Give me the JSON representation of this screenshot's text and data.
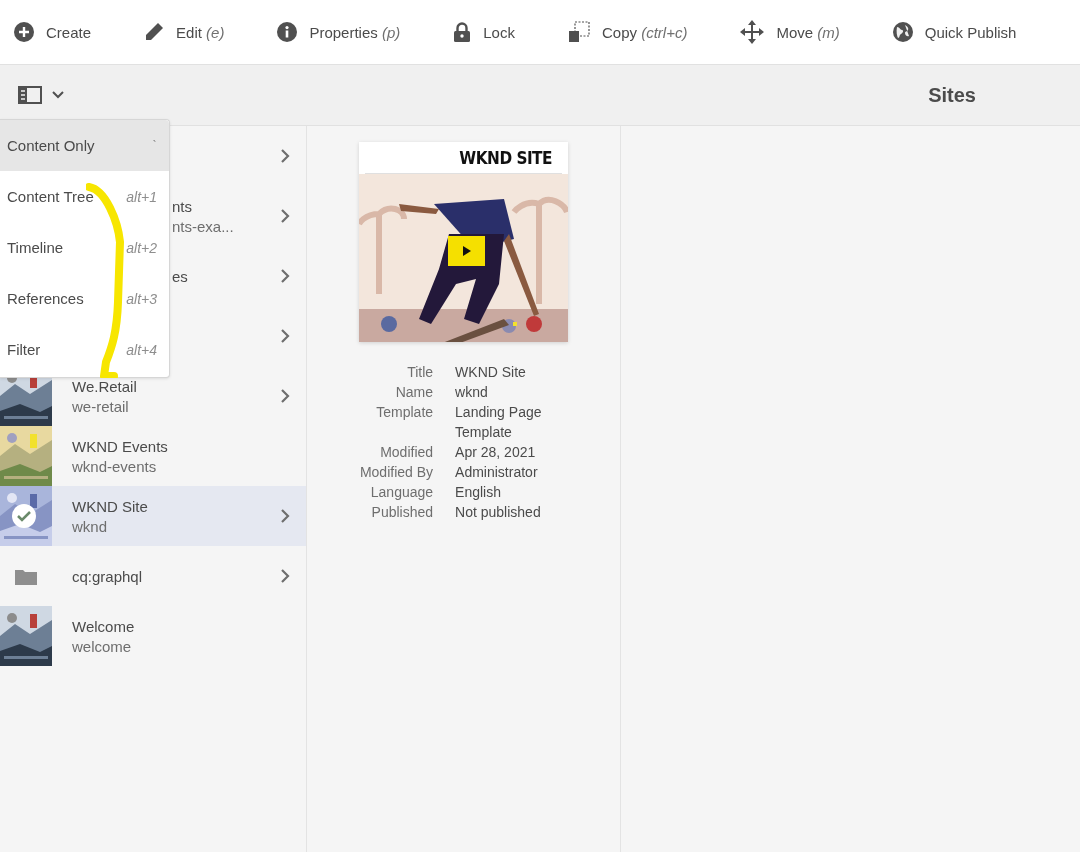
{
  "toolbar": {
    "actions": [
      {
        "kind": "create",
        "label": "Create"
      },
      {
        "kind": "edit",
        "label": "Edit",
        "shortcut": "(e)"
      },
      {
        "kind": "properties",
        "label": "Properties",
        "shortcut": "(p)"
      },
      {
        "kind": "lock",
        "label": "Lock"
      },
      {
        "kind": "copy",
        "label": "Copy",
        "shortcut": "(ctrl+c)"
      },
      {
        "kind": "move",
        "label": "Move",
        "shortcut": "(m)"
      },
      {
        "kind": "publish",
        "label": "Quick Publish"
      }
    ]
  },
  "header": {
    "title": "Sites"
  },
  "view_menu": {
    "items": [
      {
        "label": "Content Only",
        "shortcut": "`",
        "selected": true
      },
      {
        "label": "Content Tree",
        "shortcut": "alt+1",
        "selected": false
      },
      {
        "label": "Timeline",
        "shortcut": "alt+2",
        "selected": false
      },
      {
        "label": "References",
        "shortcut": "alt+3",
        "selected": false
      },
      {
        "label": "Filter",
        "shortcut": "alt+4",
        "selected": false
      }
    ]
  },
  "column": {
    "rows": [
      {
        "kind": "covered",
        "expandable": true,
        "selected": false
      },
      {
        "kind": "covered",
        "title": "nts",
        "subtitle": "nts-exa...",
        "expandable": true,
        "selected": false
      },
      {
        "kind": "covered",
        "title": "es",
        "expandable": true,
        "selected": false
      },
      {
        "kind": "covered",
        "expandable": true,
        "selected": false
      },
      {
        "kind": "page",
        "title": "We.Retail",
        "subtitle": "we-retail",
        "expandable": true,
        "selected": false
      },
      {
        "kind": "page",
        "title": "WKND Events",
        "subtitle": "wknd-events",
        "expandable": false,
        "selected": false
      },
      {
        "kind": "page",
        "title": "WKND Site",
        "subtitle": "wknd",
        "expandable": true,
        "selected": true
      },
      {
        "kind": "folder",
        "title": "cq:graphql",
        "expandable": true,
        "selected": false
      },
      {
        "kind": "page",
        "title": "Welcome",
        "subtitle": "welcome",
        "expandable": false,
        "selected": false
      }
    ]
  },
  "details": {
    "card": {
      "heading": "WKND SITE"
    },
    "properties": [
      {
        "label": "Title",
        "value": "WKND Site"
      },
      {
        "label": "Name",
        "value": "wknd"
      },
      {
        "label": "Template",
        "value": "Landing Page Template"
      },
      {
        "label": "Modified",
        "value": "Apr 28, 2021"
      },
      {
        "label": "Modified By",
        "value": "Administrator"
      },
      {
        "label": "Language",
        "value": "English"
      },
      {
        "label": "Published",
        "value": "Not published"
      }
    ]
  }
}
